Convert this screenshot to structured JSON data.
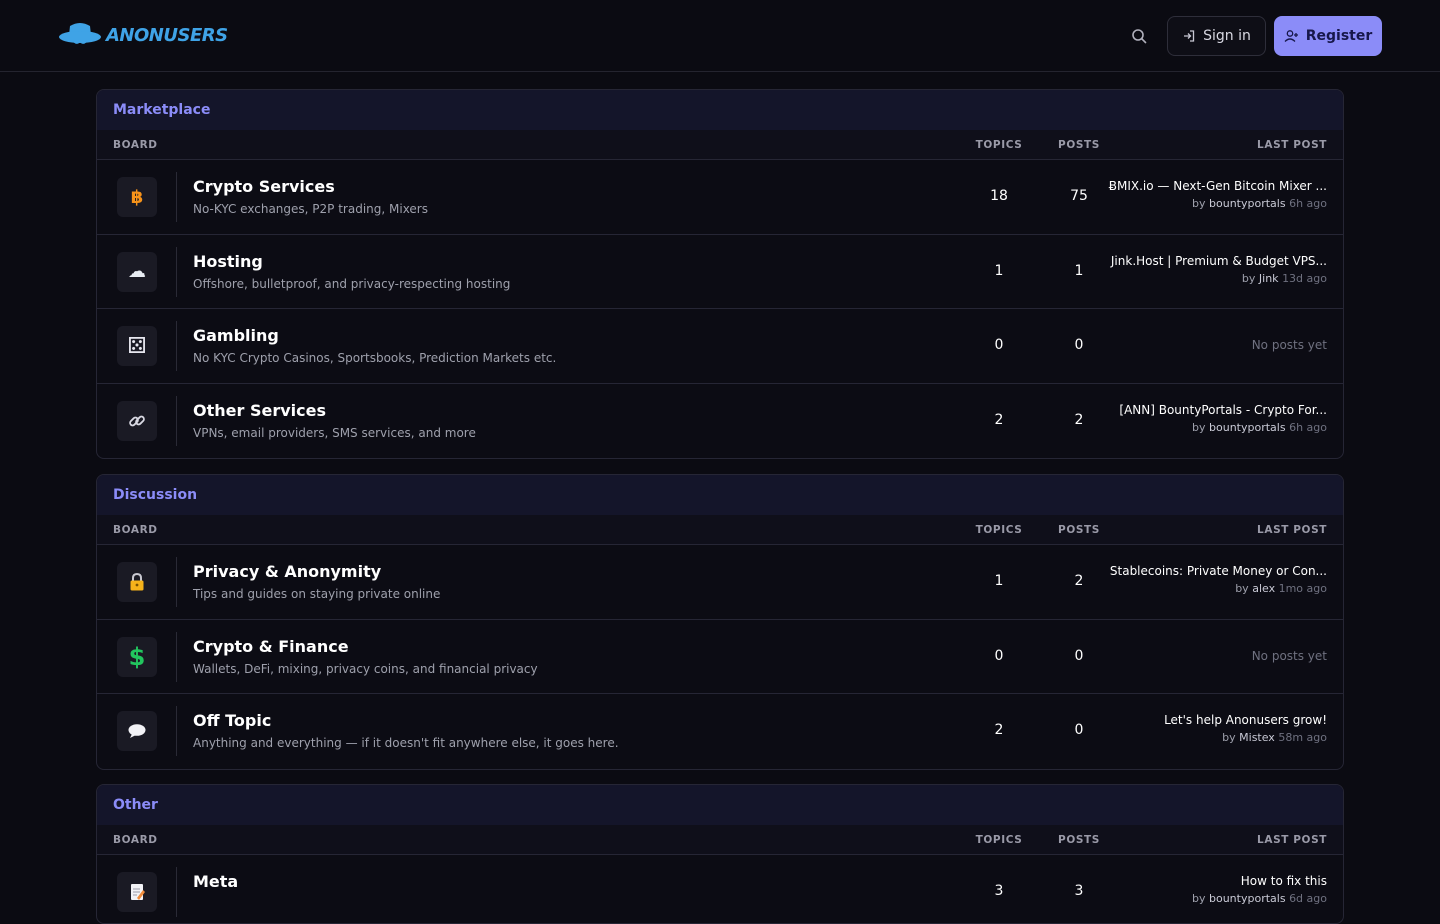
{
  "header": {
    "logo_text": "ANONUSERS",
    "signin_label": "Sign in",
    "register_label": "Register"
  },
  "columns": {
    "board": "BOARD",
    "topics": "TOPICS",
    "posts": "POSTS",
    "last_post": "LAST POST"
  },
  "sections": [
    {
      "title": "Marketplace",
      "boards": [
        {
          "icon": "bitcoin-icon",
          "glyph": "฿",
          "title": "Crypto Services",
          "desc": "No-KYC exchanges, P2P trading, Mixers",
          "topics": "18",
          "posts": "75",
          "last_title": "ɃMIX.io — Next-Gen Bitcoin Mixer ...",
          "by": "by",
          "user": "bountyportals",
          "ago": "6h ago"
        },
        {
          "icon": "cloud-icon",
          "glyph": "☁",
          "title": "Hosting",
          "desc": "Offshore, bulletproof, and privacy-respecting hosting",
          "topics": "1",
          "posts": "1",
          "last_title": "Jink.Host | Premium & Budget VPS...",
          "by": "by",
          "user": "Jink",
          "ago": "13d ago"
        },
        {
          "icon": "dice-icon",
          "glyph": "⚄",
          "title": "Gambling",
          "desc": "No KYC Crypto Casinos, Sportsbooks, Prediction Markets etc.",
          "topics": "0",
          "posts": "0",
          "no_posts": "No posts yet"
        },
        {
          "icon": "link-icon",
          "glyph": "🔗",
          "title": "Other Services",
          "desc": "VPNs, email providers, SMS services, and more",
          "topics": "2",
          "posts": "2",
          "last_title": "[ANN] BountyPortals - Crypto For...",
          "by": "by",
          "user": "bountyportals",
          "ago": "6h ago"
        }
      ]
    },
    {
      "title": "Discussion",
      "boards": [
        {
          "icon": "lock-icon",
          "glyph": "🔒",
          "title": "Privacy & Anonymity",
          "desc": "Tips and guides on staying private online",
          "topics": "1",
          "posts": "2",
          "last_title": "Stablecoins: Private Money or Con...",
          "by": "by",
          "user": "alex",
          "ago": "1mo ago"
        },
        {
          "icon": "dollar-icon",
          "glyph": "$",
          "title": "Crypto & Finance",
          "desc": "Wallets, DeFi, mixing, privacy coins, and financial privacy",
          "topics": "0",
          "posts": "0",
          "no_posts": "No posts yet"
        },
        {
          "icon": "speech-bubble-icon",
          "glyph": "💬",
          "title": "Off Topic",
          "desc": "Anything and everything — if it doesn't fit anywhere else, it goes here.",
          "topics": "2",
          "posts": "0",
          "last_title": "Let's help Anonusers grow!",
          "by": "by",
          "user": "Mistex",
          "ago": "58m ago"
        }
      ]
    },
    {
      "title": "Other",
      "boards": [
        {
          "icon": "memo-icon",
          "glyph": "📝",
          "title": "Meta",
          "desc": "",
          "topics": "3",
          "posts": "3",
          "last_title": "How to fix this",
          "by": "by",
          "user": "bountyportals",
          "ago": "6d ago"
        }
      ]
    }
  ]
}
